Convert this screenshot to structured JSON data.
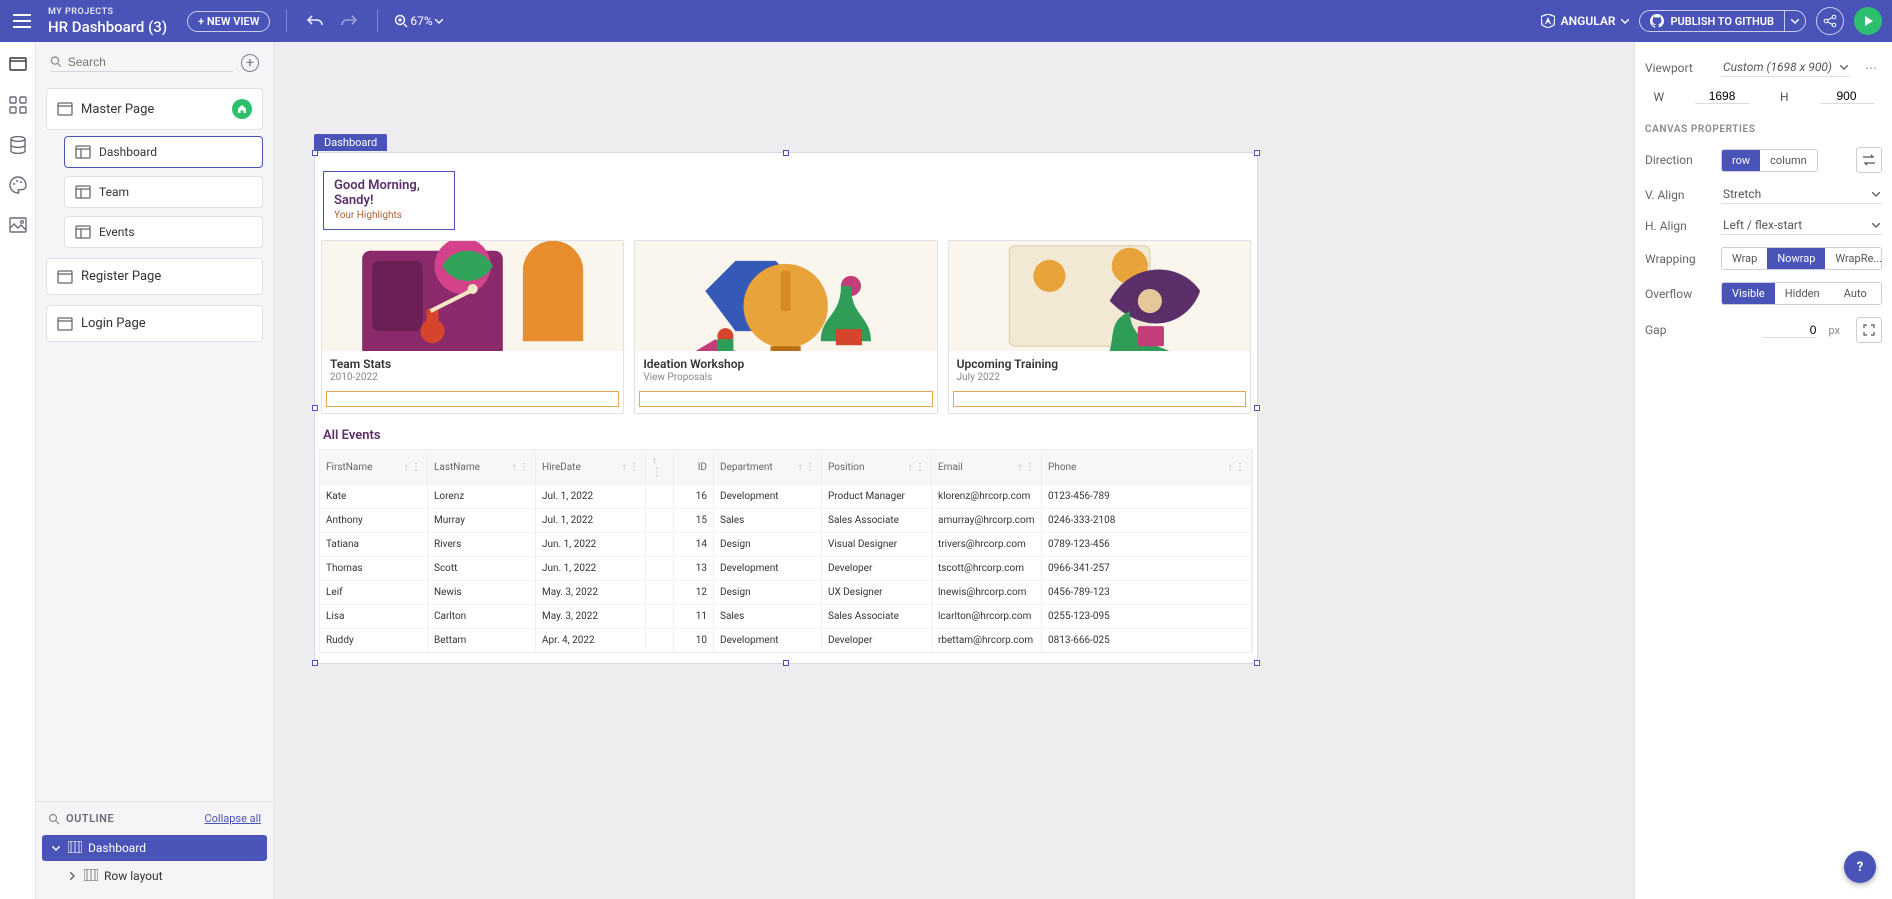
{
  "header": {
    "breadcrumb": "MY PROJECTS",
    "title": "HR Dashboard (3)",
    "new_view_label": "+ NEW VIEW",
    "zoom_value": "67%",
    "framework_label": "ANGULAR",
    "publish_label": "PUBLISH TO GITHUB"
  },
  "left": {
    "search_placeholder": "Search",
    "pages": {
      "master": "Master Page",
      "children": [
        "Dashboard",
        "Team",
        "Events"
      ],
      "siblings": [
        "Register Page",
        "Login Page"
      ]
    },
    "outline": {
      "title": "OUTLINE",
      "collapse": "Collapse all",
      "root": "Dashboard",
      "child": "Row layout"
    }
  },
  "canvas": {
    "tab_label": "Dashboard",
    "greeting_title": "Good Morning, Sandy!",
    "greeting_sub": "Your Highlights",
    "cards": [
      {
        "title": "Team Stats",
        "sub": "2010-2022"
      },
      {
        "title": "Ideation Workshop",
        "sub": "View Proposals"
      },
      {
        "title": "Upcoming Training",
        "sub": "July 2022"
      }
    ],
    "events_title": "All Events",
    "events_cols": [
      "FirstName",
      "LastName",
      "HireDate",
      "",
      "ID",
      "Department",
      "Position",
      "Email",
      "Phone"
    ],
    "events_rows": [
      {
        "fn": "Kate",
        "ln": "Lorenz",
        "hd": "Jul. 1, 2022",
        "id": "16",
        "dept": "Development",
        "pos": "Product Manager",
        "email": "klorenz@hrcorp.com",
        "phone": "0123-456-789"
      },
      {
        "fn": "Anthony",
        "ln": "Murray",
        "hd": "Jul. 1, 2022",
        "id": "15",
        "dept": "Sales",
        "pos": "Sales Associate",
        "email": "amurray@hrcorp.com",
        "phone": "0246-333-2108"
      },
      {
        "fn": "Tatiana",
        "ln": "Rivers",
        "hd": "Jun. 1, 2022",
        "id": "14",
        "dept": "Design",
        "pos": "Visual Designer",
        "email": "trivers@hrcorp.com",
        "phone": "0789-123-456"
      },
      {
        "fn": "Thomas",
        "ln": "Scott",
        "hd": "Jun. 1, 2022",
        "id": "13",
        "dept": "Development",
        "pos": "Developer",
        "email": "tscott@hrcorp.com",
        "phone": "0966-341-257"
      },
      {
        "fn": "Leif",
        "ln": "Newis",
        "hd": "May. 3, 2022",
        "id": "12",
        "dept": "Design",
        "pos": "UX Designer",
        "email": "lnewis@hrcorp.com",
        "phone": "0456-789-123"
      },
      {
        "fn": "Lisa",
        "ln": "Carlton",
        "hd": "May. 3, 2022",
        "id": "11",
        "dept": "Sales",
        "pos": "Sales Associate",
        "email": "lcarlton@hrcorp.com",
        "phone": "0255-123-095"
      },
      {
        "fn": "Ruddy",
        "ln": "Bettam",
        "hd": "Apr. 4, 2022",
        "id": "10",
        "dept": "Development",
        "pos": "Developer",
        "email": "rbettam@hrcorp.com",
        "phone": "0813-666-025"
      }
    ]
  },
  "right": {
    "viewport_label": "Viewport",
    "viewport_value": "Custom (1698 x 900)",
    "w_label": "W",
    "w_value": "1698",
    "h_label": "H",
    "h_value": "900",
    "section": "CANVAS PROPERTIES",
    "direction_label": "Direction",
    "direction": {
      "row": "row",
      "column": "column"
    },
    "valign_label": "V. Align",
    "valign_value": "Stretch",
    "halign_label": "H. Align",
    "halign_value": "Left / flex-start",
    "wrap_label": "Wrapping",
    "wrap": {
      "wrap": "Wrap",
      "nowrap": "Nowrap",
      "reverse": "WrapRe..."
    },
    "overflow_label": "Overflow",
    "overflow": {
      "visible": "Visible",
      "hidden": "Hidden",
      "auto": "Auto"
    },
    "gap_label": "Gap",
    "gap_value": "0",
    "gap_unit": "px"
  },
  "help": "?"
}
